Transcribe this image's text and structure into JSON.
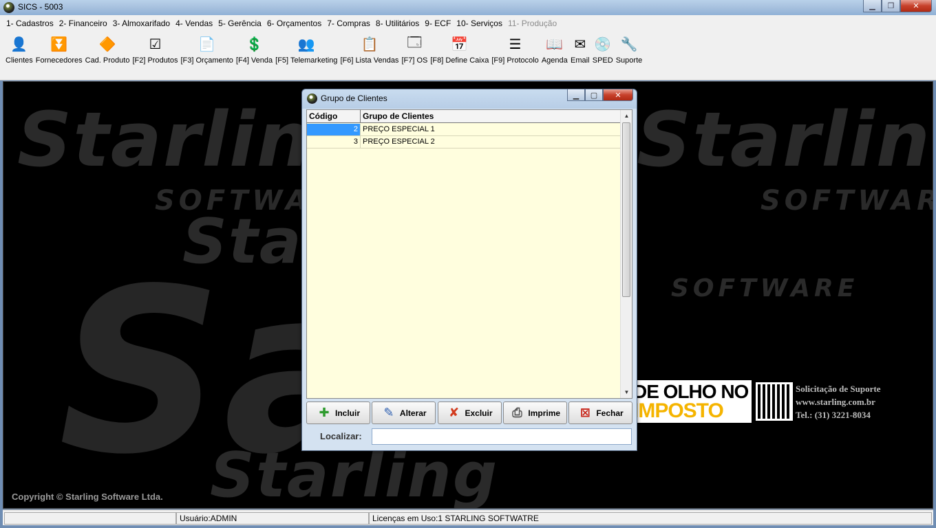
{
  "window": {
    "title": "SICS - 5003",
    "icon": "app-logo-icon"
  },
  "menu": [
    {
      "label": "1- Cadastros",
      "disabled": false
    },
    {
      "label": "2- Financeiro",
      "disabled": false
    },
    {
      "label": "3- Almoxarifado",
      "disabled": false
    },
    {
      "label": "4- Vendas",
      "disabled": false
    },
    {
      "label": "5- Gerência",
      "disabled": false
    },
    {
      "label": "6- Orçamentos",
      "disabled": false
    },
    {
      "label": "7- Compras",
      "disabled": false
    },
    {
      "label": "8- Utilitários",
      "disabled": false
    },
    {
      "label": "9- ECF",
      "disabled": false
    },
    {
      "label": "10- Serviços",
      "disabled": false
    },
    {
      "label": "11- Produção",
      "disabled": true
    }
  ],
  "toolbar": [
    {
      "label": "Clientes",
      "icon": "person-card-icon",
      "glyph": "👤"
    },
    {
      "label": "Fornecedores",
      "icon": "funnel-icon",
      "glyph": "⏬"
    },
    {
      "label": "Cad. Produto",
      "icon": "shapes-icon",
      "glyph": "🔶"
    },
    {
      "label": "[F2] Produtos",
      "icon": "checklist-icon",
      "glyph": "☑"
    },
    {
      "label": "[F3] Orçamento",
      "icon": "document-icon",
      "glyph": "📄"
    },
    {
      "label": "[F4] Venda",
      "icon": "money-document-icon",
      "glyph": "💲"
    },
    {
      "label": "[F5] Telemarketing",
      "icon": "people-icon",
      "glyph": "👥"
    },
    {
      "label": "[F6] Lista Vendas",
      "icon": "list-sales-icon",
      "glyph": "📋"
    },
    {
      "label": "[F7] OS",
      "icon": "window-form-icon",
      "glyph": "🗔"
    },
    {
      "label": "[F8] Define Caixa",
      "icon": "calendar-icon",
      "glyph": "📅"
    },
    {
      "label": "[F9] Protocolo",
      "icon": "protocol-list-icon",
      "glyph": "☰"
    },
    {
      "label": "Agenda",
      "icon": "book-icon",
      "glyph": "📖"
    },
    {
      "label": "Email",
      "icon": "envelope-icon",
      "glyph": "✉"
    },
    {
      "label": "SPED",
      "icon": "sped-disk-icon",
      "glyph": "💿"
    },
    {
      "label": "Suporte",
      "icon": "tools-icon",
      "glyph": "🔧"
    }
  ],
  "desktop": {
    "copyright": "Copyright © Starling Software Ltda.",
    "badge_line1": "DE OLHO NO",
    "badge_line2": "IMPOSTO",
    "support_title": "Solicitação de Suporte",
    "support_url": "www.starling.com.br",
    "support_phone": "Tel.: (31) 3221-8034"
  },
  "dialog": {
    "title": "Grupo de Clientes",
    "columns": [
      "Código",
      "Grupo de Clientes"
    ],
    "rows": [
      {
        "code": "2",
        "name": "PREÇO ESPECIAL 1"
      },
      {
        "code": "3",
        "name": "PREÇO ESPECIAL 2"
      }
    ],
    "buttons": {
      "incluir": "Incluir",
      "alterar": "Alterar",
      "excluir": "Excluir",
      "imprime": "Imprime",
      "fechar": "Fechar"
    },
    "find_label": "Localizar:",
    "find_value": ""
  },
  "status": {
    "user": "Usuário:ADMIN",
    "license": "Licenças em Uso:1 STARLING SOFTWATRE"
  }
}
